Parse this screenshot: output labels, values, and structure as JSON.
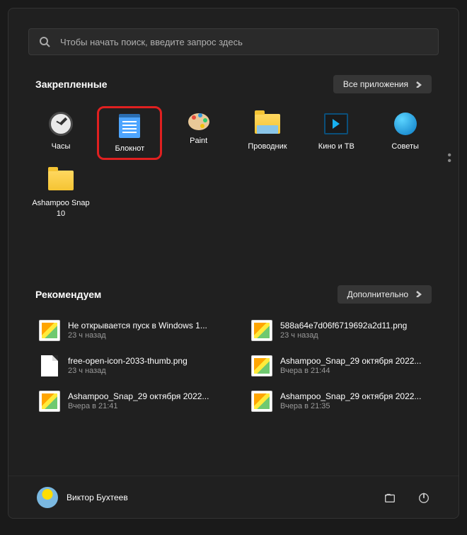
{
  "search": {
    "placeholder": "Чтобы начать поиск, введите запрос здесь"
  },
  "pinned": {
    "title": "Закрепленные",
    "all_apps": "Все приложения",
    "items": [
      {
        "label": "Часы"
      },
      {
        "label": "Блокнот"
      },
      {
        "label": "Paint"
      },
      {
        "label": "Проводник"
      },
      {
        "label": "Кино и ТВ"
      },
      {
        "label": "Советы"
      },
      {
        "label": "Ashampoo Snap 10"
      }
    ]
  },
  "recommended": {
    "title": "Рекомендуем",
    "more": "Дополнительно",
    "items": [
      {
        "title": "Не открывается пуск в Windows 1...",
        "time": "23 ч назад",
        "icon": "img"
      },
      {
        "title": "588a64e7d06f6719692a2d11.png",
        "time": "23 ч назад",
        "icon": "img"
      },
      {
        "title": "free-open-icon-2033-thumb.png",
        "time": "23 ч назад",
        "icon": "file"
      },
      {
        "title": "Ashampoo_Snap_29 октября 2022...",
        "time": "Вчера в 21:44",
        "icon": "img"
      },
      {
        "title": "Ashampoo_Snap_29 октября 2022...",
        "time": "Вчера в 21:41",
        "icon": "img"
      },
      {
        "title": "Ashampoo_Snap_29 октября 2022...",
        "time": "Вчера в 21:35",
        "icon": "img"
      }
    ]
  },
  "user": {
    "name": "Виктор Бухтеев"
  }
}
